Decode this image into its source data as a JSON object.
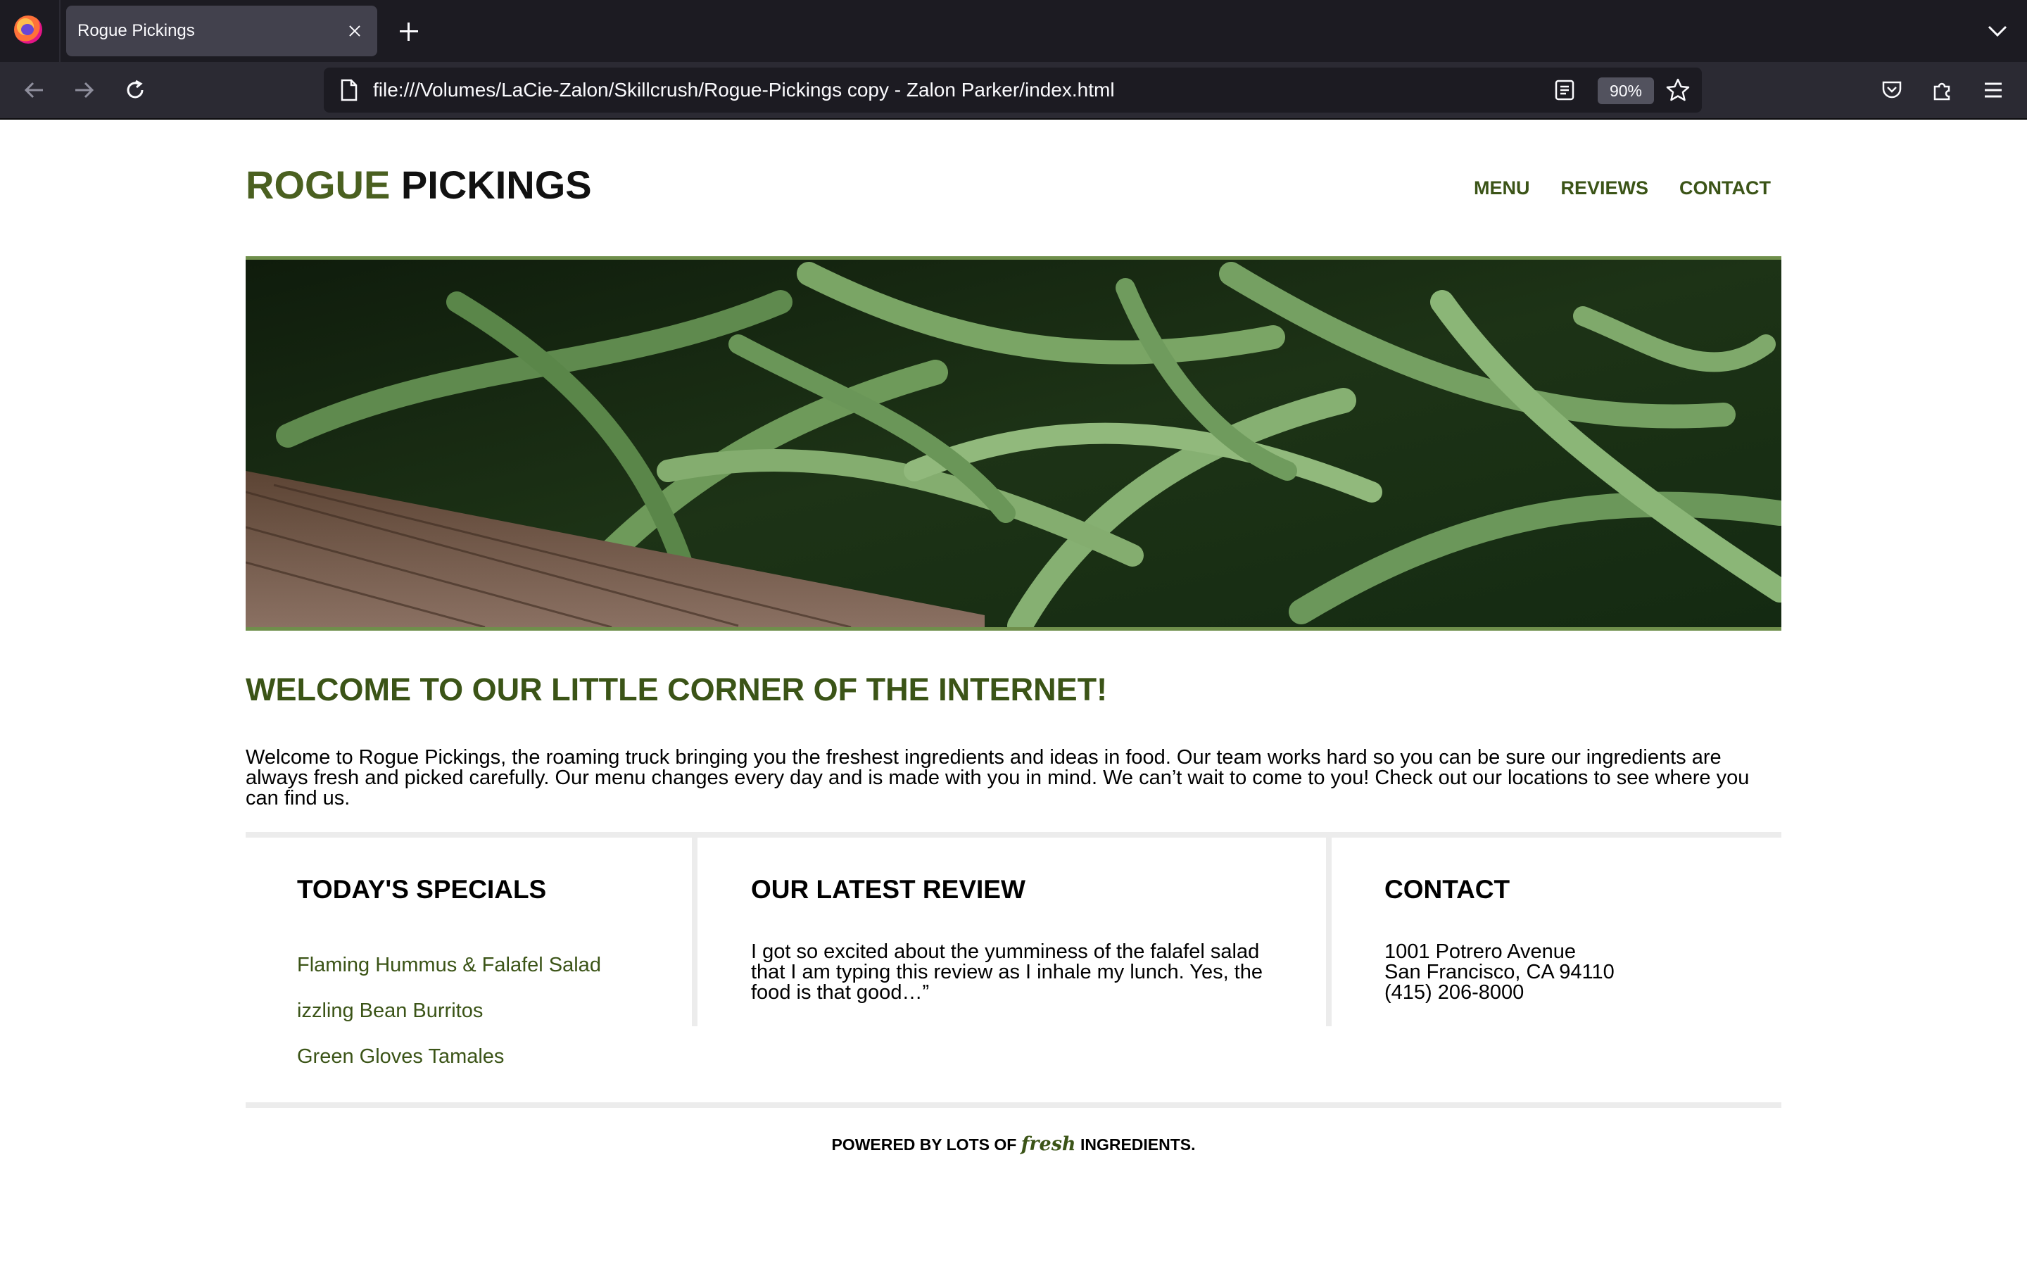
{
  "browser": {
    "tab_title": "Rogue Pickings",
    "url": "file:///Volumes/LaCie-Zalon/Skillcrush/Rogue-Pickings copy - Zalon Parker/index.html",
    "zoom": "90%"
  },
  "site": {
    "logo_part1": "ROGUE",
    "logo_part2": "PICKINGS",
    "nav": [
      "MENU",
      "REVIEWS",
      "CONTACT"
    ],
    "welcome_heading": "WELCOME TO OUR LITTLE CORNER OF THE INTERNET!",
    "welcome_text": "Welcome to Rogue Pickings, the roaming truck bringing you the freshest ingredients and ideas in food. Our team works hard so you can be sure our ingredients are always fresh and picked carefully. Our menu changes every day and is made with you in mind. We can’t wait to come to you! Check out our locations to see where you can find us.",
    "specials": {
      "heading": "TODAY'S SPECIALS",
      "items": [
        "Flaming Hummus & Falafel Salad",
        "izzling Bean Burritos",
        "Green Gloves Tamales"
      ]
    },
    "review": {
      "heading": "OUR LATEST REVIEW",
      "text": "I got so excited about the yumminess of the falafel salad that I am typing this review as I inhale my lunch. Yes, the food is that good…”"
    },
    "contact": {
      "heading": "CONTACT",
      "address_line1": "1001 Potrero Avenue",
      "address_line2": "San Francisco, CA 94110",
      "phone": "(415) 206-8000"
    },
    "footer": {
      "before": "POWERED BY LOTS OF",
      "highlight": "fresh",
      "after": "INGREDIENTS."
    }
  },
  "colors": {
    "brand_green": "#3b5417",
    "hero_border": "#6f8f4b"
  }
}
